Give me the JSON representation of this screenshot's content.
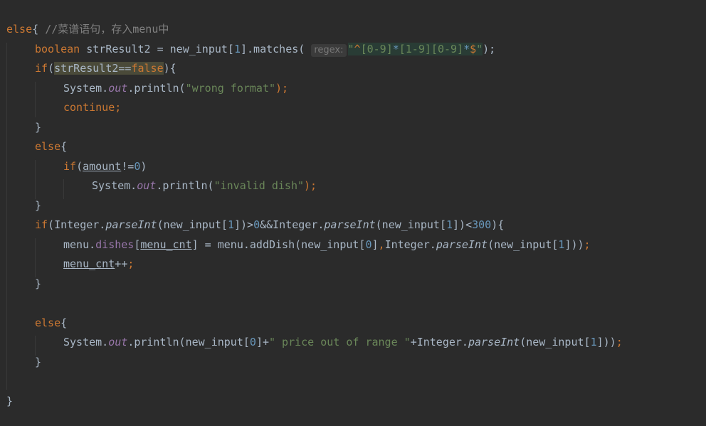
{
  "editor": {
    "line1": {
      "kw_else": "else",
      "brace": "{ ",
      "comment": "//菜谱语句，存入menu中"
    },
    "line2": {
      "kw_boolean": "boolean",
      "decl": " strResult2 = new_input[",
      "idx": "1",
      "call": "].matches( ",
      "hint": "regex:",
      "q1": "\"",
      "regex_caret": "^",
      "regex_c1o": "[",
      "regex_c1r": "0-9",
      "regex_c1c": "]",
      "regex_star1": "*",
      "regex_c2o": "[",
      "regex_c2r": "1-9",
      "regex_c2c": "]",
      "regex_c3o": "[",
      "regex_c3r": "0-9",
      "regex_c3c": "]",
      "regex_star2": "*",
      "regex_dollar": "$",
      "q2": "\"",
      "end": ");"
    },
    "line3": {
      "kw_if": "if",
      "open": "(",
      "var": "strResult2",
      "op": "==",
      "kw_false": "false",
      "close": "){"
    },
    "line4": {
      "sys": "System.",
      "out": "out",
      "call": ".println(",
      "str": "\"wrong format\"",
      "end": ");"
    },
    "line5": {
      "kw_continue": "continue;"
    },
    "line6": {
      "text": "}"
    },
    "line7": {
      "kw_else": "else",
      "brace": "{"
    },
    "line8": {
      "kw_if": "if",
      "open": "(",
      "var": "amount",
      "op": "!=",
      "num": "0",
      "close": ")"
    },
    "line9": {
      "sys": "System.",
      "out": "out",
      "call": ".println(",
      "str": "\"invalid dish\"",
      "end": ");"
    },
    "line10": {
      "text": "}"
    },
    "line11": {
      "kw_if": "if",
      "p1": "(Integer.",
      "parse1": "parseInt",
      "p2": "(new_input[",
      "n1": "1",
      "p3": "])>",
      "n2": "0",
      "p4": "&&Integer.",
      "parse2": "parseInt",
      "p5": "(new_input[",
      "n3": "1",
      "p6": "])<",
      "n4": "300",
      "p7": "){"
    },
    "line12": {
      "p1": "menu.",
      "dishes": "dishes",
      "p2": "[",
      "cnt": "menu_cnt",
      "p3": "] = menu.addDish(new_input[",
      "n1": "0",
      "p4": "]",
      "comma": ",",
      "p5": "Integer.",
      "parse": "parseInt",
      "p6": "(new_input[",
      "n2": "1",
      "p7": "]))",
      "semi": ";"
    },
    "line13": {
      "cnt": "menu_cnt",
      "op": "++",
      "semi": ";"
    },
    "line14": {
      "text": "}"
    },
    "line16": {
      "kw_else": "else",
      "brace": "{"
    },
    "line17": {
      "sys": "System.",
      "out": "out",
      "p1": ".println(new_input[",
      "n1": "0",
      "p2": "]+",
      "str": "\" price out of range \"",
      "p3": "+Integer.",
      "parse": "parseInt",
      "p4": "(new_input[",
      "n2": "1",
      "p5": "]))",
      "semi": ";"
    },
    "line18": {
      "text": "}"
    },
    "line20": {
      "text": "}"
    }
  }
}
